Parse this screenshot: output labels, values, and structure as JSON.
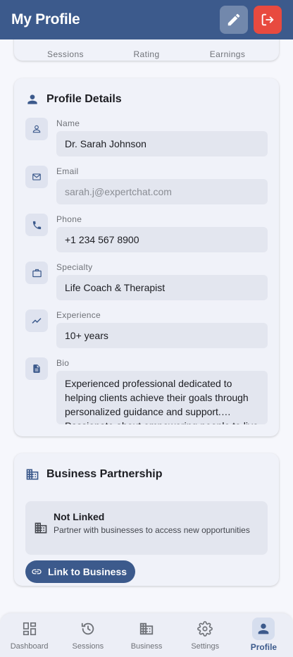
{
  "appbar": {
    "title": "My Profile"
  },
  "stats": {
    "sessions_label": "Sessions",
    "rating_label": "Rating",
    "earnings_label": "Earnings"
  },
  "profile_details": {
    "title": "Profile Details",
    "fields": [
      {
        "label": "Name",
        "value": "Dr. Sarah Johnson",
        "icon": "person-icon"
      },
      {
        "label": "Email",
        "value": "sarah.j@expertchat.com",
        "icon": "email-icon"
      },
      {
        "label": "Phone",
        "value": "+1 234 567 8900",
        "icon": "phone-icon"
      },
      {
        "label": "Specialty",
        "value": "Life Coach & Therapist",
        "icon": "briefcase-icon"
      },
      {
        "label": "Experience",
        "value": "10+ years",
        "icon": "trending-icon"
      },
      {
        "label": "Bio",
        "value": "Experienced professional dedicated to helping clients achieve their goals through personalized guidance and support. Passionate about empowering people to live their best lives.",
        "icon": "document-icon"
      }
    ]
  },
  "business": {
    "title": "Business Partnership",
    "status_title": "Not Linked",
    "status_subtitle": "Partner with businesses to access new opportunities",
    "link_button": "Link to Business"
  },
  "nav": {
    "items": [
      {
        "label": "Dashboard",
        "icon": "dashboard-icon"
      },
      {
        "label": "Sessions",
        "icon": "history-icon"
      },
      {
        "label": "Business",
        "icon": "business-icon"
      },
      {
        "label": "Settings",
        "icon": "settings-icon"
      },
      {
        "label": "Profile",
        "icon": "profile-icon",
        "active": true
      }
    ]
  },
  "colors": {
    "primary": "#3c5a8c",
    "danger": "#e84a3f",
    "background": "#f6f7fc",
    "card": "#f0f2f9"
  }
}
